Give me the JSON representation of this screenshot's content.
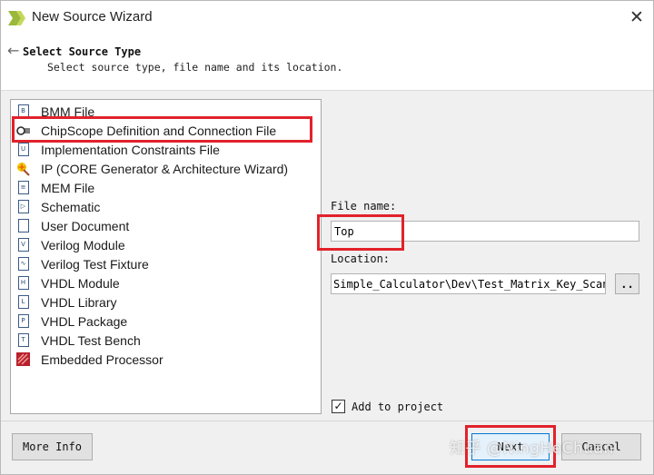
{
  "window": {
    "title": "New Source Wizard",
    "close_glyph": "✕"
  },
  "header": {
    "back_glyph": "←",
    "title": "Select Source Type",
    "subtitle": "Select source type, file name and its location."
  },
  "source_types": [
    {
      "label": "BMM File",
      "icon": "bmm-file-icon"
    },
    {
      "label": "ChipScope Definition and Connection File",
      "icon": "chipscope-icon"
    },
    {
      "label": "Implementation Constraints File",
      "icon": "constraints-file-icon"
    },
    {
      "label": "IP (CORE Generator & Architecture Wizard)",
      "icon": "ip-core-icon"
    },
    {
      "label": "MEM File",
      "icon": "mem-file-icon"
    },
    {
      "label": "Schematic",
      "icon": "schematic-icon"
    },
    {
      "label": "User Document",
      "icon": "user-document-icon"
    },
    {
      "label": "Verilog Module",
      "icon": "verilog-module-icon"
    },
    {
      "label": "Verilog Test Fixture",
      "icon": "verilog-test-fixture-icon"
    },
    {
      "label": "VHDL Module",
      "icon": "vhdl-module-icon"
    },
    {
      "label": "VHDL Library",
      "icon": "vhdl-library-icon"
    },
    {
      "label": "VHDL Package",
      "icon": "vhdl-package-icon"
    },
    {
      "label": "VHDL Test Bench",
      "icon": "vhdl-test-bench-icon"
    },
    {
      "label": "Embedded Processor",
      "icon": "embedded-processor-icon"
    }
  ],
  "form": {
    "file_name_label": "File name:",
    "file_name_value": "Top",
    "location_label": "Location:",
    "location_value": "Simple_Calculator\\Dev\\Test_Matrix_Key_Scan",
    "browse_label": "..",
    "add_to_project_label": "Add to project",
    "add_to_project_checked": true
  },
  "buttons": {
    "more_info": "More Info",
    "next": "Next",
    "cancel": "Cancel"
  },
  "watermark": "知乎 @NingHeChuan",
  "colors": {
    "highlight": "#e1222b",
    "default_button_border": "#0078d7"
  }
}
